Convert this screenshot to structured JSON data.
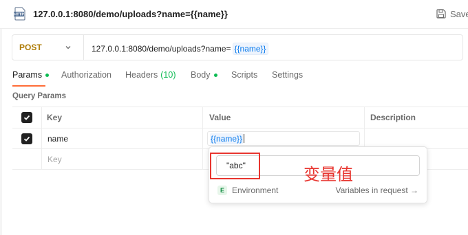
{
  "header": {
    "badge_text": "HTTP",
    "title": "127.0.0.1:8080/demo/uploads?name={{name}}",
    "save_label": "Save"
  },
  "request": {
    "method": "POST",
    "url_prefix": "127.0.0.1:8080/demo/uploads?name=",
    "url_variable": "{{name}}",
    "method_color": "#ad7a03"
  },
  "tabs": [
    {
      "label": "Params",
      "dot": true,
      "active": true
    },
    {
      "label": "Authorization"
    },
    {
      "label": "Headers",
      "count": "(10)"
    },
    {
      "label": "Body",
      "dot": true
    },
    {
      "label": "Scripts"
    },
    {
      "label": "Settings"
    }
  ],
  "query_params": {
    "title": "Query Params",
    "columns": [
      "Key",
      "Value",
      "Description"
    ],
    "rows": [
      {
        "checked": true,
        "key": "name",
        "value": "{{name}}",
        "description": ""
      }
    ],
    "new_row_placeholder": "Key"
  },
  "popover": {
    "value": "\"abc\"",
    "scope_badge": "E",
    "scope_label": "Environment",
    "link_label": "Variables in request →"
  },
  "annotation": {
    "text": "变量值",
    "color": "#e8352f"
  },
  "colors": {
    "accent": "#ff6c37",
    "variable": "#097bed",
    "status_dot": "#0cbb52"
  }
}
